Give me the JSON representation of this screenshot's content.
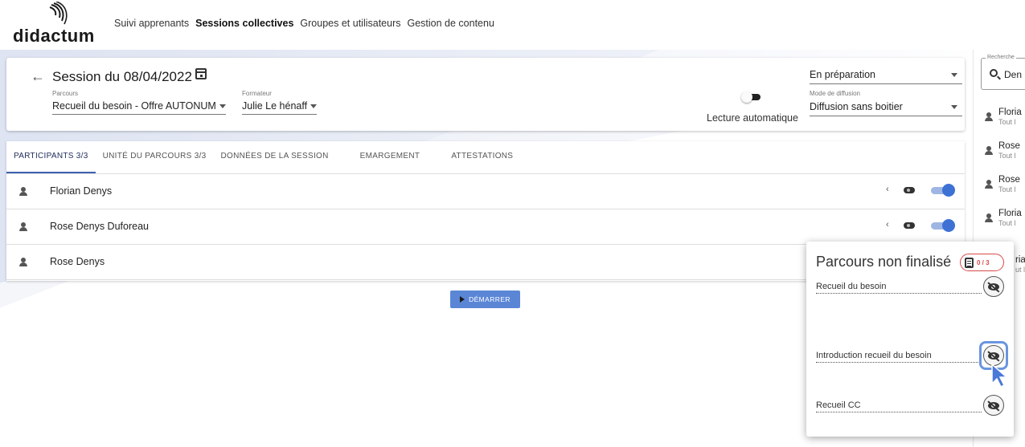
{
  "header": {
    "logo_text": "didactum",
    "nav": [
      "Suivi apprenants",
      "Sessions collectives",
      "Groupes et utilisateurs",
      "Gestion de contenu"
    ]
  },
  "session": {
    "title": "Session du 08/04/2022",
    "parcours_label": "Parcours",
    "parcours_value": "Recueil du besoin - Offre AUTONUM",
    "formateur_label": "Formateur",
    "formateur_value": "Julie Le hénaff",
    "lecture_label": "Lecture automatique",
    "status_value": "En préparation",
    "diffusion_label": "Mode de diffusion",
    "diffusion_value": "Diffusion sans boitier"
  },
  "tabs": [
    "PARTICIPANTS 3/3",
    "UNITÉ DU PARCOURS 3/3",
    "DONNÉES DE LA SESSION",
    "EMARGEMENT",
    "ATTESTATIONS"
  ],
  "participants": [
    "Florian Denys",
    "Rose Denys Duforeau",
    "Rose Denys"
  ],
  "start_button": "DÉMARRER",
  "search": {
    "label": "Recherche",
    "value": "Den"
  },
  "learners": [
    {
      "name": "Floria",
      "sub": "Tout l"
    },
    {
      "name": "Rose",
      "sub": "Tout l"
    },
    {
      "name": "Rose",
      "sub": "Tout l"
    },
    {
      "name": "Floria",
      "sub": "Tout l"
    },
    {
      "name": "ria",
      "sub": "ut l"
    }
  ],
  "popup": {
    "title": "Parcours non finalisé",
    "badge": "0 / 3",
    "items": [
      "Recueil du besoin",
      "Introduction recueil du besoin",
      "Recueil CC"
    ]
  },
  "colors": {
    "accent": "#3d72d4",
    "badge": "#d84a4a",
    "button": "#5b86d6"
  }
}
